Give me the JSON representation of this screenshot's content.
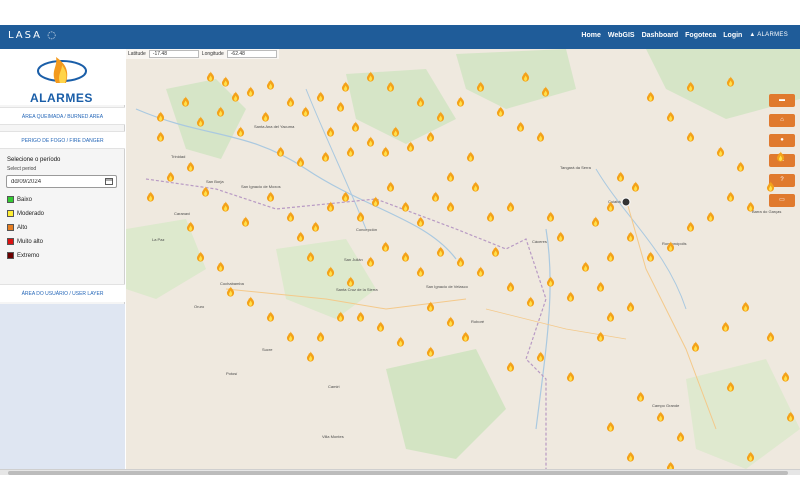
{
  "header": {
    "logo": "LASA",
    "nav": [
      "Home",
      "WebGIS",
      "Dashboard",
      "Fogoteca",
      "Login"
    ],
    "brand_mini": "ALARMES"
  },
  "sidebar": {
    "brand": "ALARMES",
    "burned_area_link": "ÁREA QUEIMADA / BURNED AREA",
    "fire_danger_link": "PERIGO DE FOGO / FIRE DANGER",
    "period_title": "Selecione o período",
    "period_sub": "Select period",
    "date_value": "dd/09/2024",
    "legend": [
      {
        "label": "Baixo",
        "color": "#33cc33"
      },
      {
        "label": "Moderado",
        "color": "#ffee33"
      },
      {
        "label": "Alto",
        "color": "#e67e22"
      },
      {
        "label": "Muito alto",
        "color": "#dd1111"
      },
      {
        "label": "Extremo",
        "color": "#6b0000"
      }
    ],
    "user_area_link": "ÁREA DO USUÁRIO / USER LAYER"
  },
  "map": {
    "lat_label": "Latitude",
    "lat_value": "-17.48",
    "lon_label": "Longitude",
    "lon_value": "-62.48",
    "tool_icons": [
      "layers-icon",
      "home-icon",
      "info-icon",
      "upload-icon",
      "help-icon",
      "camera-icon"
    ],
    "tool_glyphs": [
      "▬",
      "⌂",
      "●",
      "▲",
      "?",
      "▭"
    ],
    "cities": [
      {
        "name": "Santa Ana del Yacuma"
      },
      {
        "name": "Trinidad"
      },
      {
        "name": "San Borja"
      },
      {
        "name": "San Ignacio de Moxos"
      },
      {
        "name": "Caranavi"
      },
      {
        "name": "La Paz"
      },
      {
        "name": "Cochabamba"
      },
      {
        "name": "Oruro"
      },
      {
        "name": "Sucre"
      },
      {
        "name": "Potosí"
      },
      {
        "name": "Santa Cruz de la Sierra"
      },
      {
        "name": "San Julián"
      },
      {
        "name": "Concepción"
      },
      {
        "name": "San Ignacio de Velasco"
      },
      {
        "name": "Roboré"
      },
      {
        "name": "Camiri"
      },
      {
        "name": "Villa Montes"
      },
      {
        "name": "Tangará da Serra"
      },
      {
        "name": "Cuiabá"
      },
      {
        "name": "Rondonópolis"
      },
      {
        "name": "Campo Grande"
      },
      {
        "name": "Barra do Garças"
      },
      {
        "name": "Cáceres"
      }
    ]
  }
}
